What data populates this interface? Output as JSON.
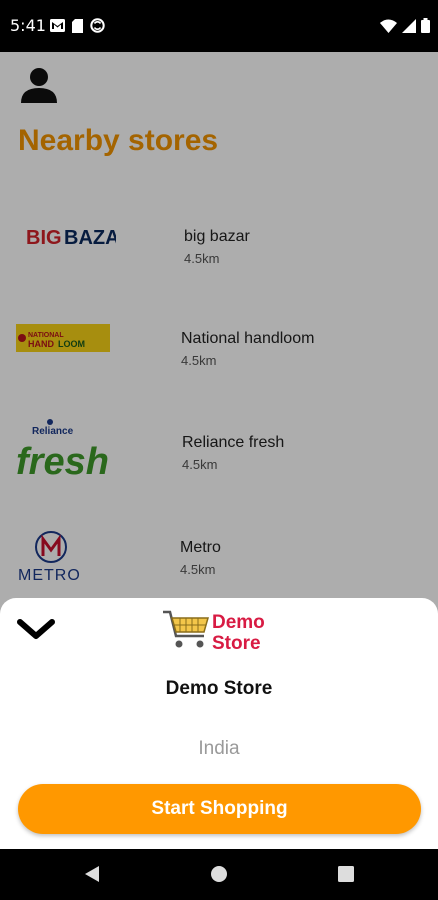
{
  "status_bar": {
    "time": "5:41",
    "icons_left": [
      "gmail-icon",
      "sd-card-icon",
      "sync-icon"
    ],
    "icons_right": [
      "wifi-icon",
      "signal-icon",
      "battery-icon"
    ]
  },
  "header": {
    "profile_icon": "person-icon",
    "title": "Nearby stores"
  },
  "stores": [
    {
      "name": "big bazar",
      "distance": "4.5km",
      "logo_text": "BIG BAZAAR"
    },
    {
      "name": "National handloom",
      "distance": "4.5km",
      "logo_text": "NATIONAL HANDLOOM"
    },
    {
      "name": "Reliance fresh",
      "distance": "4.5km",
      "logo_text": "Reliance fresh"
    },
    {
      "name": "Metro",
      "distance": "4.5km",
      "logo_text": "METRO"
    }
  ],
  "sheet": {
    "logo_text_line1": "Demo",
    "logo_text_line2": "Store",
    "title": "Demo Store",
    "country": "India",
    "cta_label": "Start Shopping"
  },
  "colors": {
    "accent": "#f29400",
    "button": "#ff9800"
  },
  "nav_bar": {
    "icons": [
      "back-icon",
      "home-icon",
      "recents-icon"
    ]
  }
}
